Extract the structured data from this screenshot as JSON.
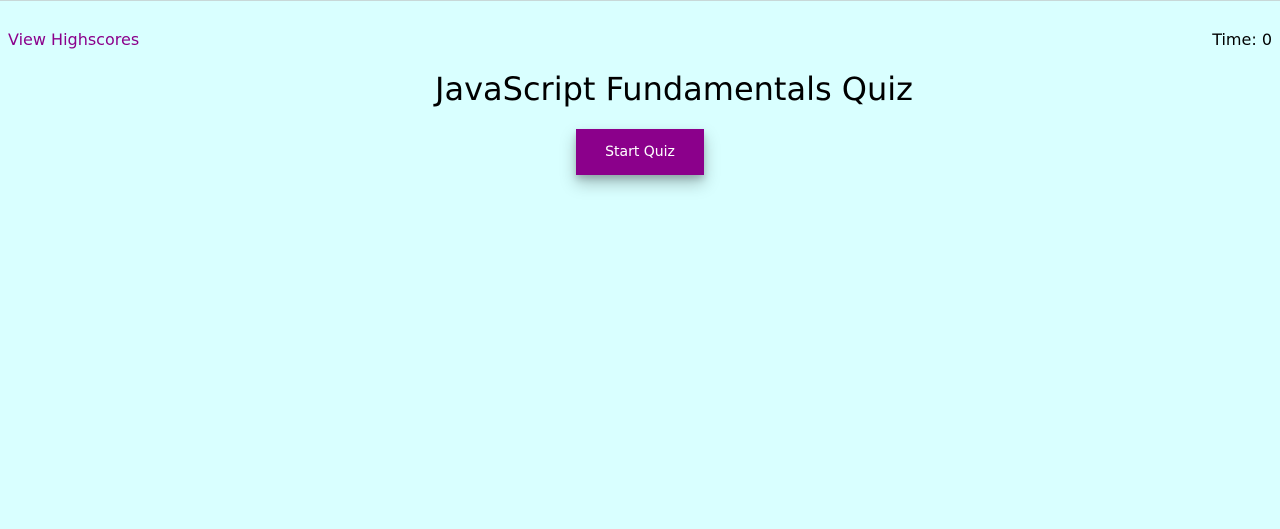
{
  "header": {
    "highscores_label": "View Highscores",
    "timer_text": "Time: 0"
  },
  "main": {
    "title": "JavaScript Fundamentals Quiz",
    "start_label": "Start Quiz"
  },
  "colors": {
    "background": "#d9ffff",
    "accent": "#8b008b",
    "text": "#000000"
  }
}
